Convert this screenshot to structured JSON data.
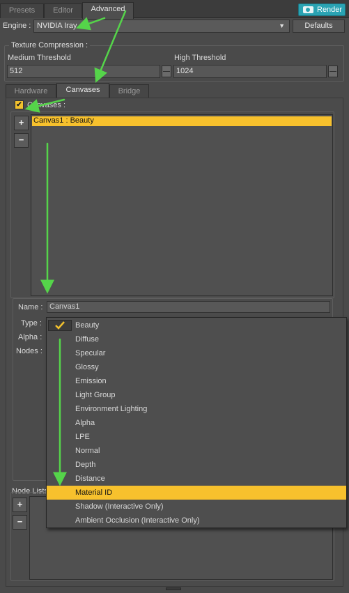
{
  "top_tabs": [
    "Presets",
    "Editor",
    "Advanced"
  ],
  "active_top_tab": "Advanced",
  "render_button": "Render",
  "engine": {
    "label": "Engine :",
    "value": "NVIDIA Iray",
    "defaults_label": "Defaults"
  },
  "texture_compression": {
    "title": "Texture Compression :",
    "medium_label": "Medium Threshold",
    "medium_value": "512",
    "high_label": "High Threshold",
    "high_value": "1024"
  },
  "sub_tabs": [
    "Hardware",
    "Canvases",
    "Bridge"
  ],
  "active_sub_tab": "Canvases",
  "canvases": {
    "checkbox_label": "Canvases :",
    "checked": true,
    "add_label": "+",
    "remove_label": "−",
    "items": [
      "Canvas1 : Beauty"
    ],
    "selected": "Canvas1 : Beauty"
  },
  "canvas_props": {
    "name_label": "Name :",
    "name_value": "Canvas1",
    "type_label": "Type :",
    "alpha_label": "Alpha :",
    "nodes_label": "Nodes :"
  },
  "type_dropdown": {
    "checked_item": "Beauty",
    "highlighted_item": "Material ID",
    "options": [
      "Beauty",
      "Diffuse",
      "Specular",
      "Glossy",
      "Emission",
      "Light Group",
      "Environment Lighting",
      "Alpha",
      "LPE",
      "Normal",
      "Depth",
      "Distance",
      "Material ID",
      "Shadow (Interactive Only)",
      "Ambient Occlusion (Interactive Only)"
    ]
  },
  "node_lists": {
    "label": "Node Lists",
    "add_label": "+",
    "remove_label": "−"
  },
  "colors": {
    "accent_yellow": "#f7c12d",
    "render_teal": "#2aa3b3",
    "arrow_green": "#55d44a",
    "background": "#4a4a4a"
  }
}
